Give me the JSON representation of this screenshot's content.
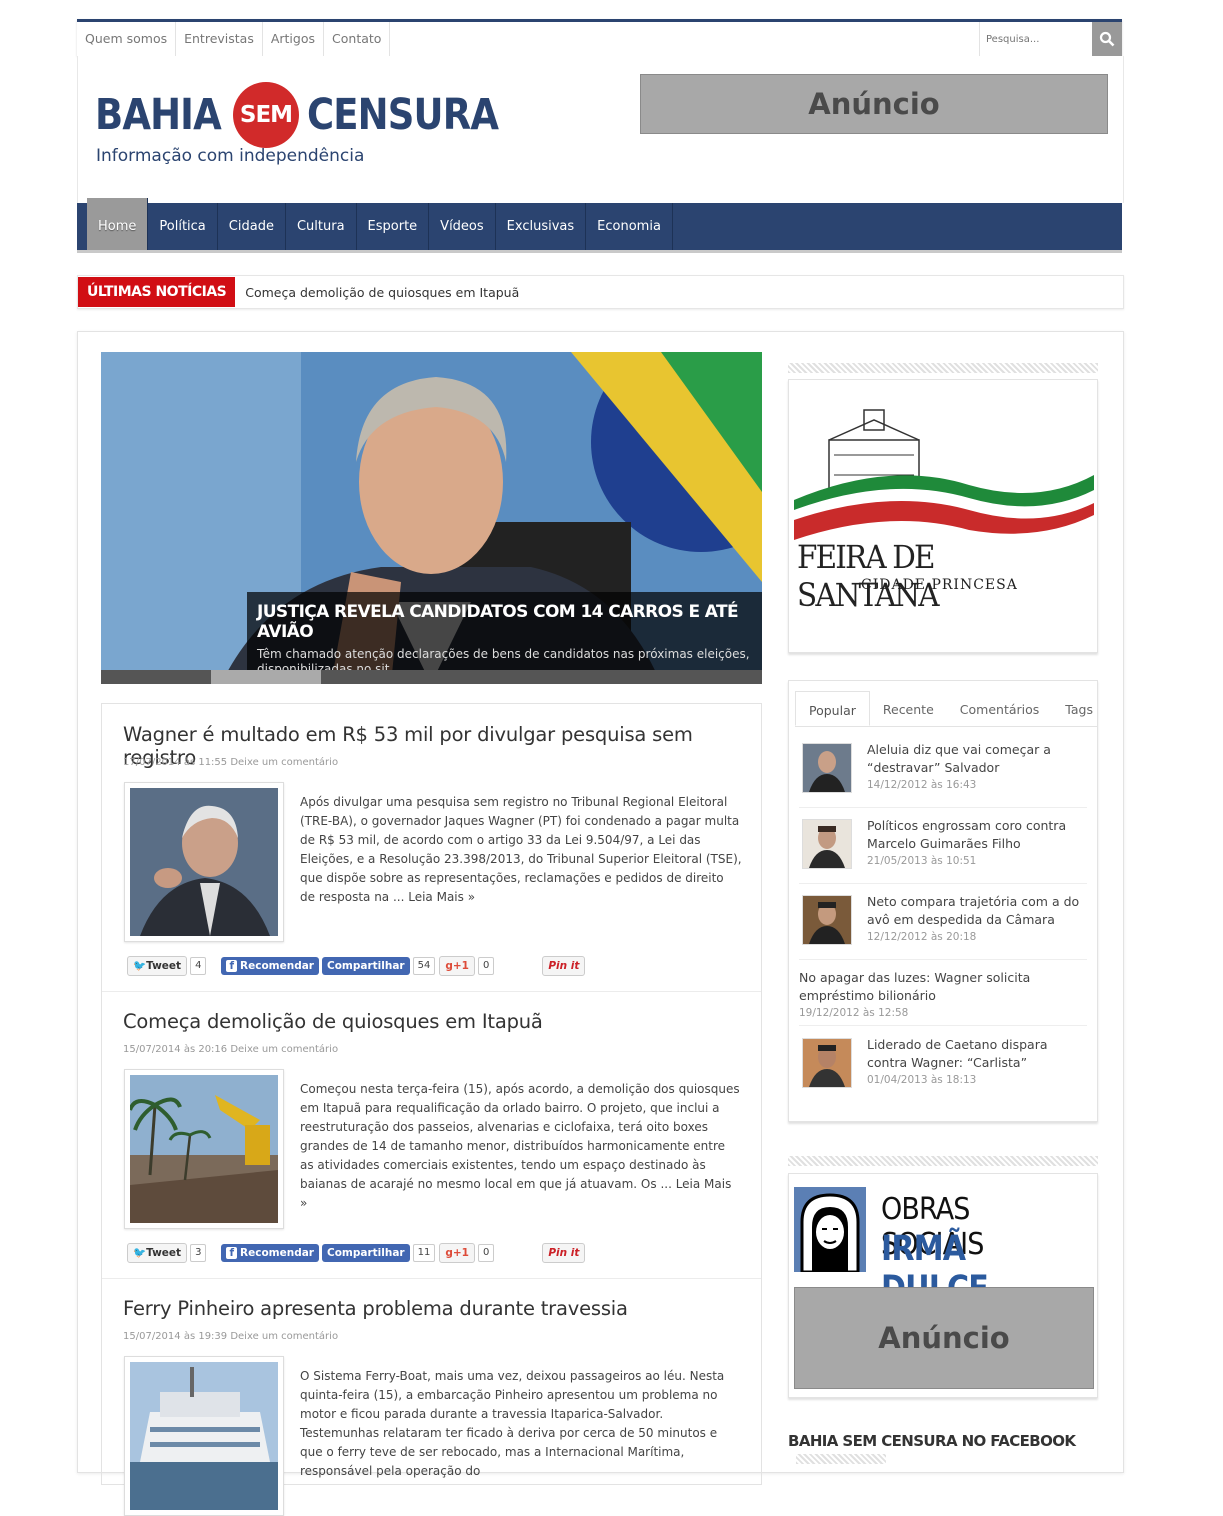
{
  "topnav": {
    "items": [
      "Quem somos",
      "Entrevistas",
      "Artigos",
      "Contato"
    ],
    "search_placeholder": "Pesquisa..."
  },
  "logo": {
    "bahia": "BAHIA",
    "sem": "SEM",
    "censura": "CENSURA",
    "tagline": "Informação com independência"
  },
  "ad_label": "Anúncio",
  "mainnav": {
    "items": [
      "Home",
      "Política",
      "Cidade",
      "Cultura",
      "Esporte",
      "Vídeos",
      "Exclusivas",
      "Economia"
    ],
    "active": "Home"
  },
  "ticker": {
    "label": "ÚLTIMAS NOTÍCIAS",
    "text": "Começa demolição de quiosques em Itapuã"
  },
  "slider": {
    "title": "JUSTIÇA REVELA CANDIDATOS COM 14 CARROS E ATÉ AVIÃO",
    "desc": "Têm chamado atenção declarações de bens de candidatos nas próximas eleições, disponibilizadas no sit..."
  },
  "posts": [
    {
      "title": "Wagner é multado em R$ 53 mil por divulgar pesquisa sem registro",
      "meta": "17/07/2014 às 11:55 Deixe um comentário",
      "excerpt": "Após divulgar uma pesquisa sem registro no Tribunal Regional Eleitoral (TRE-BA), o governador Jaques Wagner (PT) foi condenado a pagar multa de R$ 53 mil, de acordo com o artigo 33 da Lei 9.504/97, a Lei das Eleições, e a Resolução 23.398/2013, do Tribunal Superior Eleitoral (TSE), que dispõe sobre as representações, reclamações e pedidos de direito de resposta na ... Leia Mais »",
      "tweet": "4",
      "fb": "54",
      "gplus": "0"
    },
    {
      "title": "Começa demolição de quiosques em Itapuã",
      "meta": "15/07/2014 às 20:16 Deixe um comentário",
      "excerpt": "Começou nesta terça-feira (15), após acordo, a demolição dos quiosques em Itapuã para requalificação da orlado bairro. O projeto, que inclui a reestruturação dos passeios, alvenarias e ciclofaixa, terá oito boxes grandes de 14 de tamanho menor, distribuídos harmonicamente entre as atividades comerciais existentes, tendo um espaço destinado às baianas de acarajé no mesmo local em que já atuavam. Os ... Leia Mais »",
      "tweet": "3",
      "fb": "11",
      "gplus": "0"
    },
    {
      "title": "Ferry Pinheiro apresenta problema durante travessia",
      "meta": "15/07/2014 às 19:39 Deixe um comentário",
      "excerpt": "O Sistema Ferry-Boat, mais uma vez, deixou passageiros ao léu. Nesta quinta-feira (15), a embarcação Pinheiro apresentou um problema no motor e ficou parada durante a travessia Itaparica-Salvador. Testemunhas relataram ter ficado à deriva por cerca de 50 minutos e que o ferry teve de ser rebocado, mas a Internacional Marítima, responsável pela operação do",
      "tweet": "",
      "fb": "",
      "gplus": ""
    }
  ],
  "share": {
    "tweet": "Tweet",
    "recommend": "Recomendar",
    "share": "Compartilhar",
    "gplus": "+1",
    "pin": "Pin it"
  },
  "sidebar": {
    "feira": {
      "line1": "FEIRA DE SANTANA",
      "line2": "CIDADE PRINCESA"
    },
    "tabs": [
      "Popular",
      "Recente",
      "Comentários",
      "Tags"
    ],
    "popular": [
      {
        "title": "Aleluia diz que vai começar a “destravar” Salvador",
        "date": "14/12/2012 às 16:43"
      },
      {
        "title": "Políticos engrossam coro contra Marcelo Guimarães Filho",
        "date": "21/05/2013 às 10:51"
      },
      {
        "title": "Neto compara trajetória com a do avô em despedida da Câmara",
        "date": "12/12/2012 às 20:18"
      },
      {
        "title": "No apagar das luzes: Wagner solicita empréstimo bilionário",
        "date": "19/12/2012 às 12:58"
      },
      {
        "title": "Liderado de Caetano dispara contra Wagner: “Carlista”",
        "date": "01/04/2013 às 18:13"
      }
    ],
    "obras": {
      "line1": "OBRAS SOCIAIS",
      "line2": "IRMÃ DULCE"
    },
    "facebook_title": "BAHIA SEM CENSURA NO FACEBOOK"
  },
  "colors": {
    "brand_blue": "#2b4470",
    "brand_red": "#d12a2a",
    "ticker_red": "#d10e14"
  }
}
